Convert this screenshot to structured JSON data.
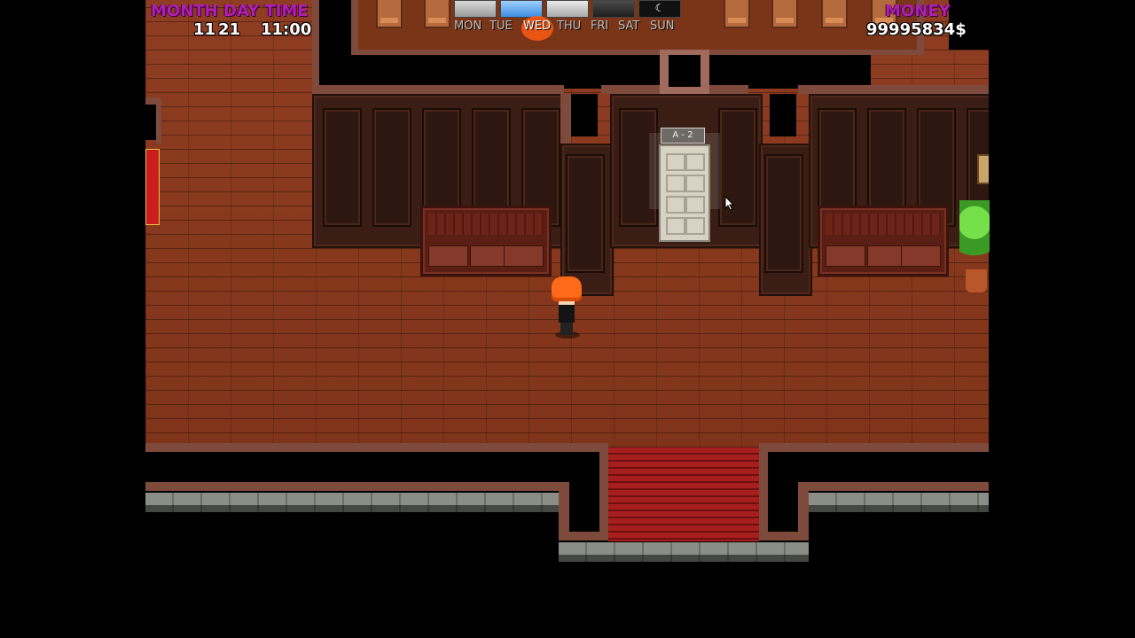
{
  "hud": {
    "date_label": "MONTH DAY TIME",
    "month": "11",
    "day": "21",
    "time": "11:00",
    "money_label": "MONEY",
    "money_value": "99995834$"
  },
  "weekdays": [
    "MON",
    "TUE",
    "WED",
    "THU",
    "FRI",
    "SAT",
    "SUN"
  ],
  "current_weekday_index": 2,
  "room": {
    "door_sign": "A - 2"
  },
  "colors": {
    "hud_label": "#b01fb0",
    "day_marker": "#ff5a14",
    "floor": "#8a3a1f",
    "carpet": "#a61e1e"
  },
  "icons": [
    "mouse-cursor-icon",
    "weather-icon"
  ]
}
